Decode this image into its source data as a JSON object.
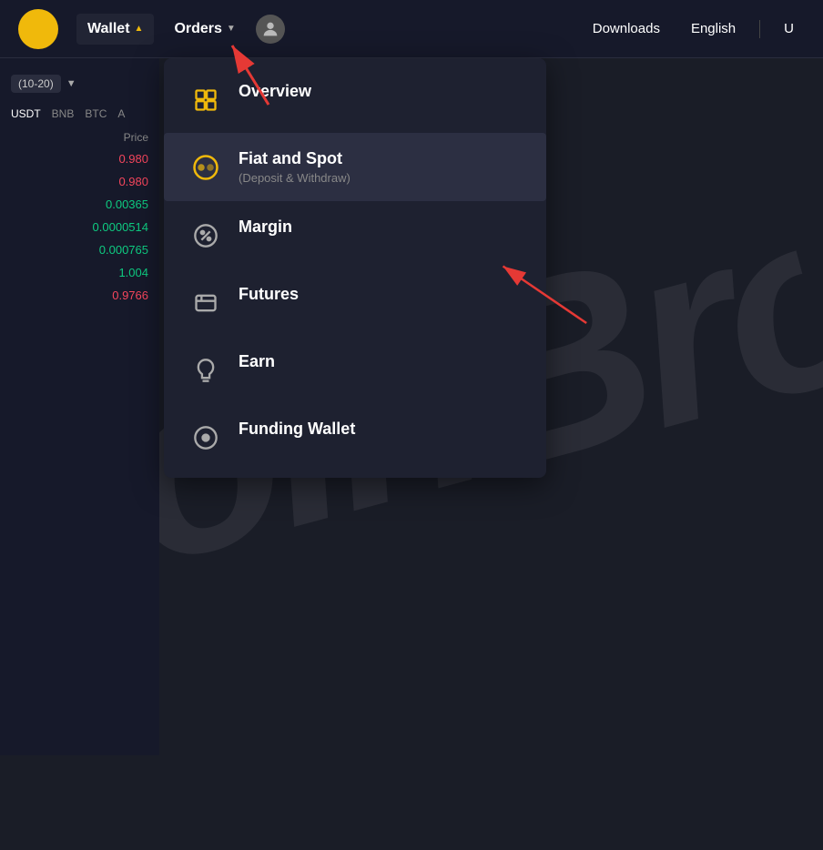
{
  "navbar": {
    "wallet_label": "Wallet",
    "orders_label": "Orders",
    "downloads_label": "Downloads",
    "english_label": "English",
    "user_label": "U"
  },
  "dropdown": {
    "items": [
      {
        "id": "overview",
        "label": "Overview",
        "sublabel": "",
        "icon": "grid"
      },
      {
        "id": "fiat-spot",
        "label": "Fiat and Spot",
        "sublabel": "(Deposit & Withdraw)",
        "icon": "coin",
        "selected": true
      },
      {
        "id": "margin",
        "label": "Margin",
        "sublabel": "",
        "icon": "percent"
      },
      {
        "id": "futures",
        "label": "Futures",
        "sublabel": "",
        "icon": "futures"
      },
      {
        "id": "earn",
        "label": "Earn",
        "sublabel": "",
        "icon": "piggy"
      },
      {
        "id": "funding",
        "label": "Funding Wallet",
        "sublabel": "",
        "icon": "circle-dot"
      }
    ]
  },
  "left_panel": {
    "filter_label": "(10-20)",
    "columns": [
      "USDT",
      "BNB",
      "BTC",
      "A"
    ],
    "price_header": "Price",
    "prices": [
      {
        "value": "0.980",
        "color": "red"
      },
      {
        "value": "0.980",
        "color": "red"
      },
      {
        "value": "0.00365",
        "color": "green"
      },
      {
        "value": "0.0000514",
        "color": "green"
      },
      {
        "value": "0.000765",
        "color": "green"
      },
      {
        "value": "1.004",
        "color": "green"
      },
      {
        "value": "0.9766",
        "color": "red"
      }
    ]
  }
}
